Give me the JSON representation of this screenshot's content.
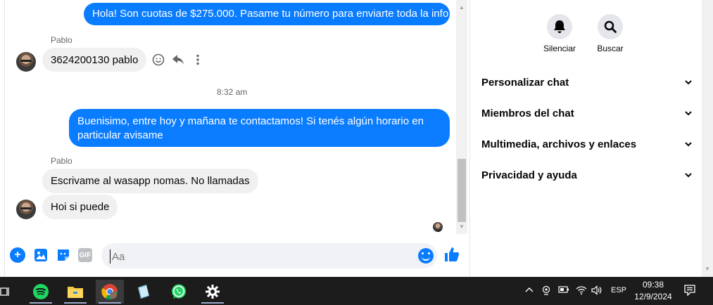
{
  "chat": {
    "messages": [
      {
        "text": "Hola! Son cuotas de $275.000. Pasame tu número para enviarte toda la info"
      },
      {
        "sender": "Pablo",
        "text": "3624200130 pablo"
      },
      {
        "timestamp": "8:32 am"
      },
      {
        "text_line1": "Buenisimo, entre hoy y mañana te contactamos! Si tenés algún horario en",
        "text_line2": "particular avisame"
      },
      {
        "sender": "Pablo",
        "text": "Escrivame al wasapp nomas. No llamadas"
      },
      {
        "text": "Hoi si puede"
      }
    ],
    "composer": {
      "placeholder": "Aa"
    }
  },
  "panel": {
    "mute_label": "Silenciar",
    "search_label": "Buscar",
    "sections": [
      {
        "label": "Personalizar chat"
      },
      {
        "label": "Miembros del chat"
      },
      {
        "label": "Multimedia, archivos y enlaces"
      },
      {
        "label": "Privacidad y ayuda"
      }
    ]
  },
  "taskbar": {
    "language": "ESP",
    "time": "09:38",
    "date": "12/9/2024",
    "apps": [
      "task-view",
      "spotify",
      "file-explorer",
      "chrome",
      "notepad",
      "whatsapp",
      "settings"
    ]
  },
  "colors": {
    "accent": "#0a7cff",
    "incoming_bubble": "#f0f0f0",
    "taskbar": "#1c1c1c"
  }
}
